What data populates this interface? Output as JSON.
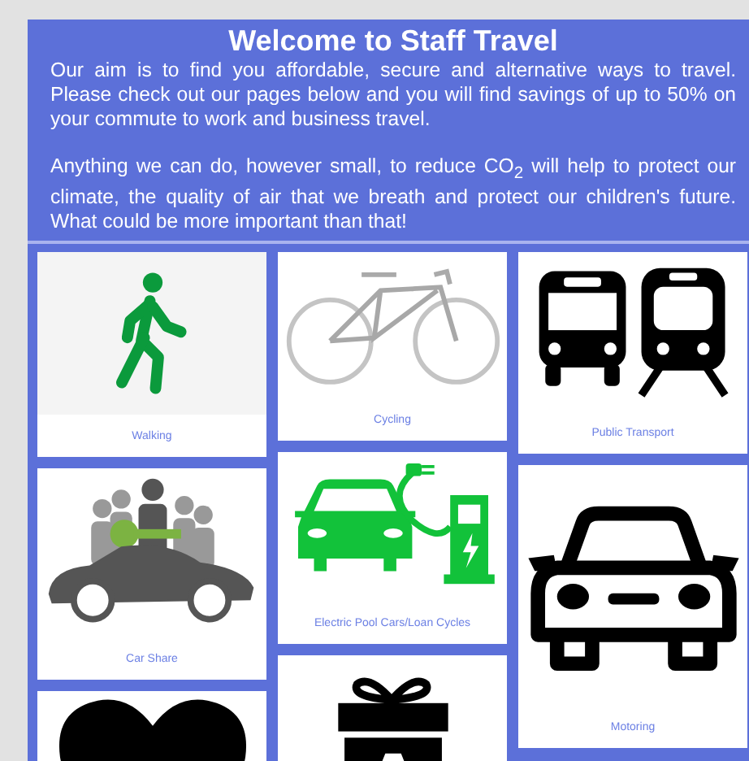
{
  "title": "Welcome to Staff Travel",
  "paragraphs": [
    "Our aim is to find you affordable, secure and alternative ways to travel. Please check out our pages below and you will find savings of up to 50% on your commute to work and business travel.",
    "Anything we can do, however small, to reduce CO$_{2}$ will help to protect our climate, the quality of air that we breath and protect our children's future.  What could be more important than that!"
  ],
  "columns": [
    [
      {
        "kind": "walking",
        "label": "Walking"
      },
      {
        "kind": "carshare",
        "label": "Car Share"
      },
      {
        "kind": "heart"
      }
    ],
    [
      {
        "kind": "cycling",
        "label": "Cycling"
      },
      {
        "kind": "electric",
        "label": "Electric Pool Cars/Loan Cycles"
      },
      {
        "kind": "gift"
      }
    ],
    [
      {
        "kind": "transport",
        "label": "Public Transport"
      },
      {
        "kind": "motoring",
        "label": "Motoring"
      }
    ]
  ]
}
